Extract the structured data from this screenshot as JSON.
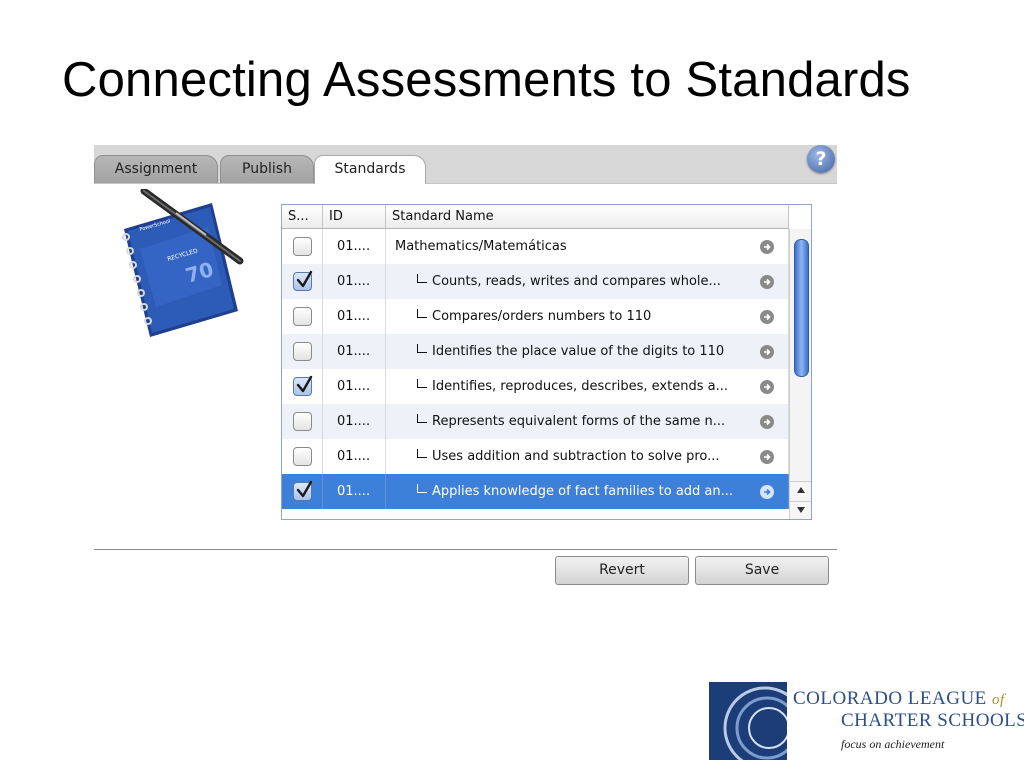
{
  "slide": {
    "title": "Connecting Assessments to Standards"
  },
  "tabs": [
    {
      "label": "Assignment",
      "active": false
    },
    {
      "label": "Publish",
      "active": false
    },
    {
      "label": "Standards",
      "active": true
    }
  ],
  "help": {
    "glyph": "?"
  },
  "notebook": {
    "brand": "PowerSchool",
    "recycled_label": "RECYCLED",
    "count": "70"
  },
  "table": {
    "columns": {
      "select": "S...",
      "id": "ID",
      "name": "Standard Name"
    },
    "rows": [
      {
        "checked": false,
        "id": "01....",
        "name": "Mathematics/Matemáticas",
        "level": 0,
        "selected": false
      },
      {
        "checked": true,
        "id": "01....",
        "name": "Counts, reads, writes and compares whole...",
        "level": 1,
        "selected": false
      },
      {
        "checked": false,
        "id": "01....",
        "name": "Compares/orders numbers to 110",
        "level": 1,
        "selected": false
      },
      {
        "checked": false,
        "id": "01....",
        "name": "Identifies the place value of the digits to 110",
        "level": 1,
        "selected": false
      },
      {
        "checked": true,
        "id": "01....",
        "name": "Identifies, reproduces, describes, extends a...",
        "level": 1,
        "selected": false
      },
      {
        "checked": false,
        "id": "01....",
        "name": "Represents equivalent forms of the same n...",
        "level": 1,
        "selected": false
      },
      {
        "checked": false,
        "id": "01....",
        "name": "Uses addition and subtraction to solve pro...",
        "level": 1,
        "selected": false
      },
      {
        "checked": true,
        "id": "01....",
        "name": "Applies knowledge of fact families to add an...",
        "level": 1,
        "selected": true
      }
    ]
  },
  "buttons": {
    "revert": "Revert",
    "save": "Save"
  },
  "logo": {
    "line1_main": "COLORADO LEAGUE",
    "line1_of": "of",
    "line2": "CHARTER SCHOOLS",
    "tagline": "focus on achievement"
  },
  "colors": {
    "selection": "#3d80d9",
    "logo_blue": "#1d3d78",
    "logo_text": "#2c4f86"
  }
}
